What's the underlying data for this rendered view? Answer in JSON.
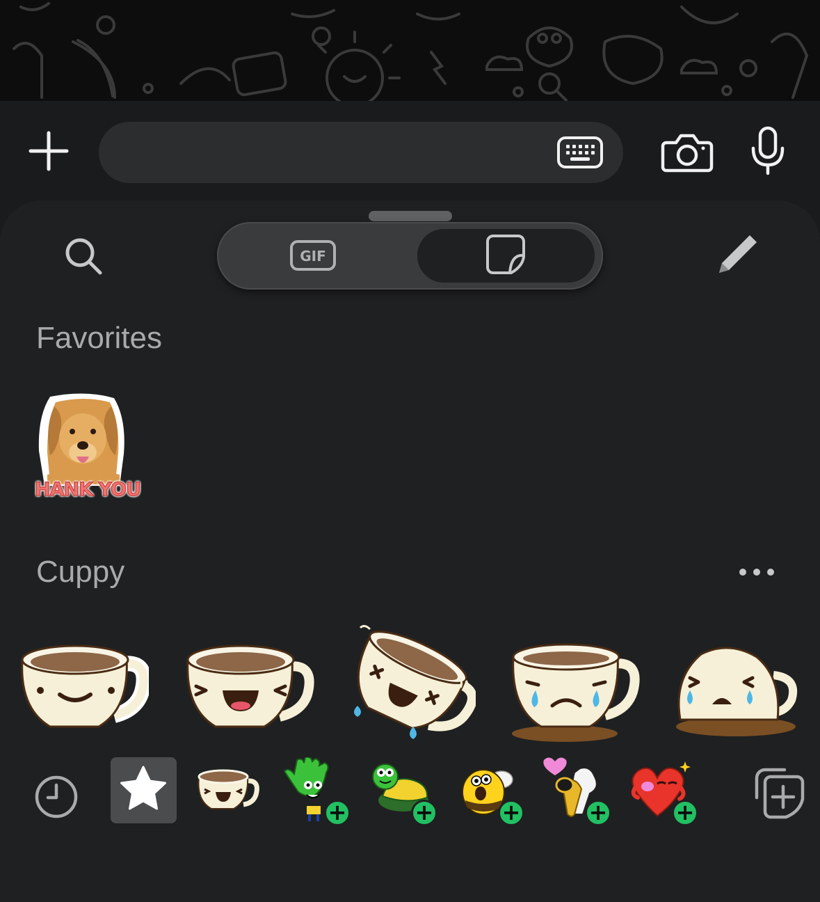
{
  "composer": {
    "message_placeholder": "",
    "message_value": ""
  },
  "picker": {
    "segments": [
      {
        "label": "GIF",
        "selected": false
      },
      {
        "label": "sticker",
        "selected": true
      }
    ]
  },
  "sections": {
    "favorites_title": "Favorites",
    "cuppy_title": "Cuppy"
  },
  "favorites": [
    {
      "name": "golden-retriever-thank-you-sticker",
      "caption": "HANK YOU"
    }
  ],
  "cuppy_stickers": [
    "smiling-cup",
    "laughing-cup",
    "tipsy-cup",
    "crying-spilled-cup",
    "crying-tipped-cup"
  ],
  "tray": {
    "items": [
      "recent",
      "favorites",
      "cuppy",
      "hand",
      "turtle",
      "bee",
      "saxophone",
      "heart",
      "add-pack"
    ]
  },
  "colors": {
    "background": "#1a1b1c",
    "panel": "#1f2021",
    "input": "#2c2d2f",
    "accent_green": "#21c063",
    "label_gray": "#a9aaac"
  },
  "icons": [
    "plus-icon",
    "keyboard-icon",
    "camera-icon",
    "microphone-icon",
    "search-icon",
    "gif-icon",
    "sticker-icon",
    "pencil-icon",
    "more-icon",
    "clock-icon",
    "star-icon",
    "add-sticker-pack-icon"
  ]
}
